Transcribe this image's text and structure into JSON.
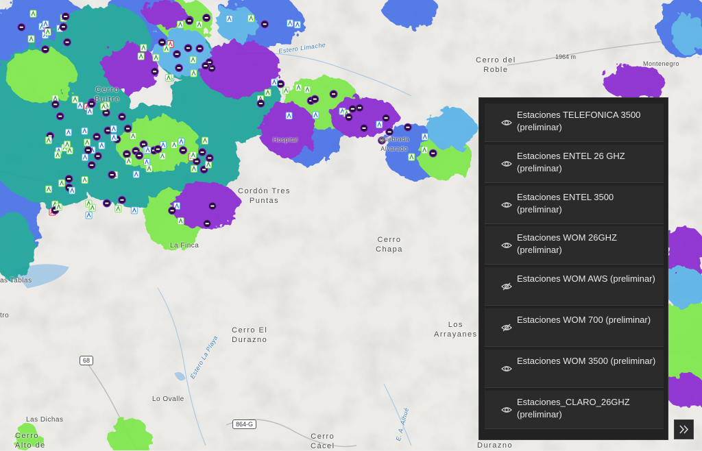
{
  "map": {
    "colors": {
      "terrain": "#ecebe7",
      "hill_shade": "#d6d4cf",
      "water": "#a9cbe6",
      "teal": "#1fa39a",
      "green": "#7ee84b",
      "purple": "#8a2bd1",
      "blue": "#4a72e8",
      "light_blue": "#5ab3e8"
    },
    "place_labels": {
      "cerro_buitre": "Cerro\nBuitre",
      "cerro_del_roble": "Cerro del\nRoble",
      "cordon_tres_puntas": "Cordón Tres\nPuntas",
      "cerro_chapa": "Cerro\nChapa",
      "cerro_el_durazno": "Cerro El\nDurazno",
      "los_arrayanes": "Los\nArrayanes",
      "lo_ovalle": "Lo Ovalle",
      "las_dichas": "Las Dichas",
      "cerro_alto_de": "Cerro\nAlto de",
      "cerro_cacel": "Cerro\nCácel",
      "durazno": "Durazno",
      "las_tablas": "as Tablas",
      "trio": "tro",
      "la_finca": "La Finca",
      "montenegro": "Montenegro",
      "quebrada_alvarado": "Quebrada\nAlvarado",
      "hospital": "Hospital"
    },
    "water_labels": {
      "estero_limache": "Estero Limache",
      "estero_la_playa": "Estero La Playa",
      "estero_a_alhue": "E. A. Alhué"
    },
    "elevation_label": "1964 m",
    "route_shields": {
      "r68": "68",
      "r864g": "864-G"
    },
    "icons": [
      "tower-icon-green",
      "tower-icon-blue",
      "tower-icon-purple",
      "tower-icon-red"
    ]
  },
  "layer_list": {
    "items": [
      {
        "label": "Estaciones TELEFONICA 3500 (preliminar)",
        "icon": "eye-icon"
      },
      {
        "label": "Estaciones ENTEL 26 GHZ (preliminar)",
        "icon": "eye-icon"
      },
      {
        "label": "Estaciones ENTEL 3500 (preliminar)",
        "icon": "eye-icon"
      },
      {
        "label": "Estaciones WOM 26GHZ (preliminar)",
        "icon": "eye-icon"
      },
      {
        "label": "Estaciones WOM AWS (preliminar)",
        "icon": "eye-off-icon"
      },
      {
        "label": "Estaciones WOM 700 (preliminar)",
        "icon": "eye-off-icon"
      },
      {
        "label": "Estaciones WOM 3500 (preliminar)",
        "icon": "eye-icon"
      },
      {
        "label": "Estaciones_CLARO_26GHZ (preliminar)",
        "icon": "eye-icon"
      }
    ],
    "panel_color": "#222222",
    "item_color": "#2b2b2b",
    "text_color": "#e8e8e8"
  },
  "collapse_button": {
    "icon": "chevron-double-right-icon"
  }
}
